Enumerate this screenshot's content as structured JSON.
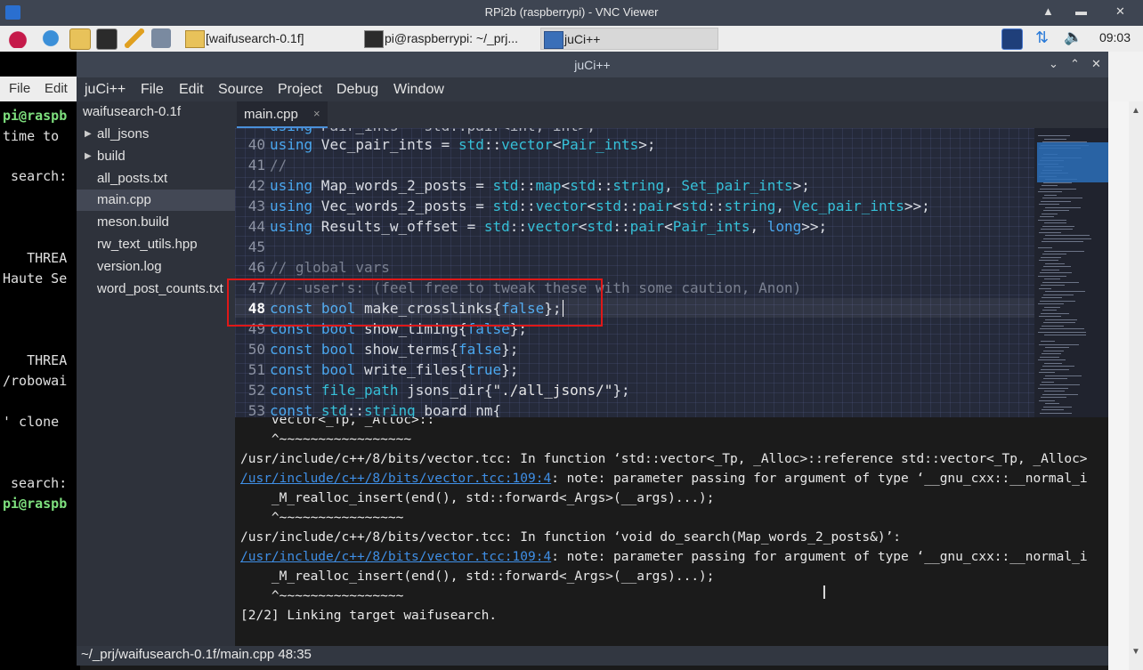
{
  "vnc": {
    "title": "RPi2b (raspberrypi) - VNC Viewer",
    "icon": "vnc-icon"
  },
  "taskbar": {
    "tasks": [
      {
        "label": "[waifusearch-0.1f]",
        "icon": "folder-icon"
      },
      {
        "label": "pi@raspberrypi: ~/_prj...",
        "icon": "terminal-icon"
      },
      {
        "label": "juCi++",
        "icon": "juci-window-icon"
      }
    ],
    "clock": "09:03"
  },
  "background_terminal": {
    "menu": [
      "File",
      "Edit"
    ],
    "lines": [
      "pi@raspb",
      "time to ",
      "",
      " search:",
      "",
      "",
      "",
      "   THREA",
      "Haute Se",
      "",
      "",
      "",
      "   THREA",
      "/robowai",
      "",
      "' clone ",
      "",
      "",
      " search:",
      "pi@raspb"
    ]
  },
  "juci": {
    "title": "juCi++",
    "menu": [
      "juCi++",
      "File",
      "Edit",
      "Source",
      "Project",
      "Debug",
      "Window"
    ],
    "tree": {
      "root": "waifusearch-0.1f",
      "items": [
        {
          "label": "all_jsons",
          "folder": true
        },
        {
          "label": "build",
          "folder": true
        },
        {
          "label": "all_posts.txt",
          "folder": false
        },
        {
          "label": "main.cpp",
          "folder": false,
          "selected": true
        },
        {
          "label": "meson.build",
          "folder": false
        },
        {
          "label": "rw_text_utils.hpp",
          "folder": false
        },
        {
          "label": "version.log",
          "folder": false
        },
        {
          "label": "word_post_counts.txt",
          "folder": false
        }
      ]
    },
    "tab": {
      "label": "main.cpp",
      "close": "×"
    },
    "editor": {
      "lines": [
        {
          "num": "40",
          "code": "using Vec_pair_ints = std::vector<Pair_ints>;"
        },
        {
          "num": "41",
          "code": "//"
        },
        {
          "num": "42",
          "code": "using Map_words_2_posts = std::map<std::string, Set_pair_ints>;"
        },
        {
          "num": "43",
          "code": "using Vec_words_2_posts = std::vector<std::pair<std::string, Vec_pair_ints>>;"
        },
        {
          "num": "44",
          "code": "using Results_w_offset = std::vector<std::pair<Pair_ints, long>>;"
        },
        {
          "num": "45",
          "code": ""
        },
        {
          "num": "46",
          "code": "// global vars"
        },
        {
          "num": "47",
          "code": "// -user's: (feel free to tweak these with some caution, Anon)"
        },
        {
          "num": "48",
          "code": "const bool make_crosslinks{false};"
        },
        {
          "num": "49",
          "code": "const bool show_timing{false};"
        },
        {
          "num": "50",
          "code": "const bool show_terms{false};"
        },
        {
          "num": "51",
          "code": "const bool write_files{true};"
        },
        {
          "num": "52",
          "code": "const file_path jsons_dir{\"./all_jsons/\"};"
        },
        {
          "num": "53",
          "code": "const std::string board_nm{"
        }
      ],
      "current_line": "48"
    },
    "terminal": {
      "lines": [
        {
          "text": "    vector<_Tp, _Alloc>::"
        },
        {
          "text": "    ^~~~~~~~~~~~~~~~~~"
        },
        {
          "text": "/usr/include/c++/8/bits/vector.tcc: In function ‘std::vector<_Tp, _Alloc>::reference std::vector<_Tp, _Alloc>"
        },
        {
          "link": "/usr/include/c++/8/bits/vector.tcc:109:4",
          "text": ": note: parameter passing for argument of type ‘__gnu_cxx::__normal_i"
        },
        {
          "text": "    _M_realloc_insert(end(), std::forward<_Args>(__args)...);"
        },
        {
          "text": "    ^~~~~~~~~~~~~~~~~"
        },
        {
          "text": "/usr/include/c++/8/bits/vector.tcc: In function ‘void do_search(Map_words_2_posts&)’:"
        },
        {
          "link": "/usr/include/c++/8/bits/vector.tcc:109:4",
          "text": ": note: parameter passing for argument of type ‘__gnu_cxx::__normal_i"
        },
        {
          "text": "    _M_realloc_insert(end(), std::forward<_Args>(__args)...);"
        },
        {
          "text": "    ^~~~~~~~~~~~~~~~~"
        },
        {
          "text": "[2/2] Linking target waifusearch."
        }
      ]
    },
    "status": "~/_prj/waifusearch-0.1f/main.cpp 48:35"
  }
}
